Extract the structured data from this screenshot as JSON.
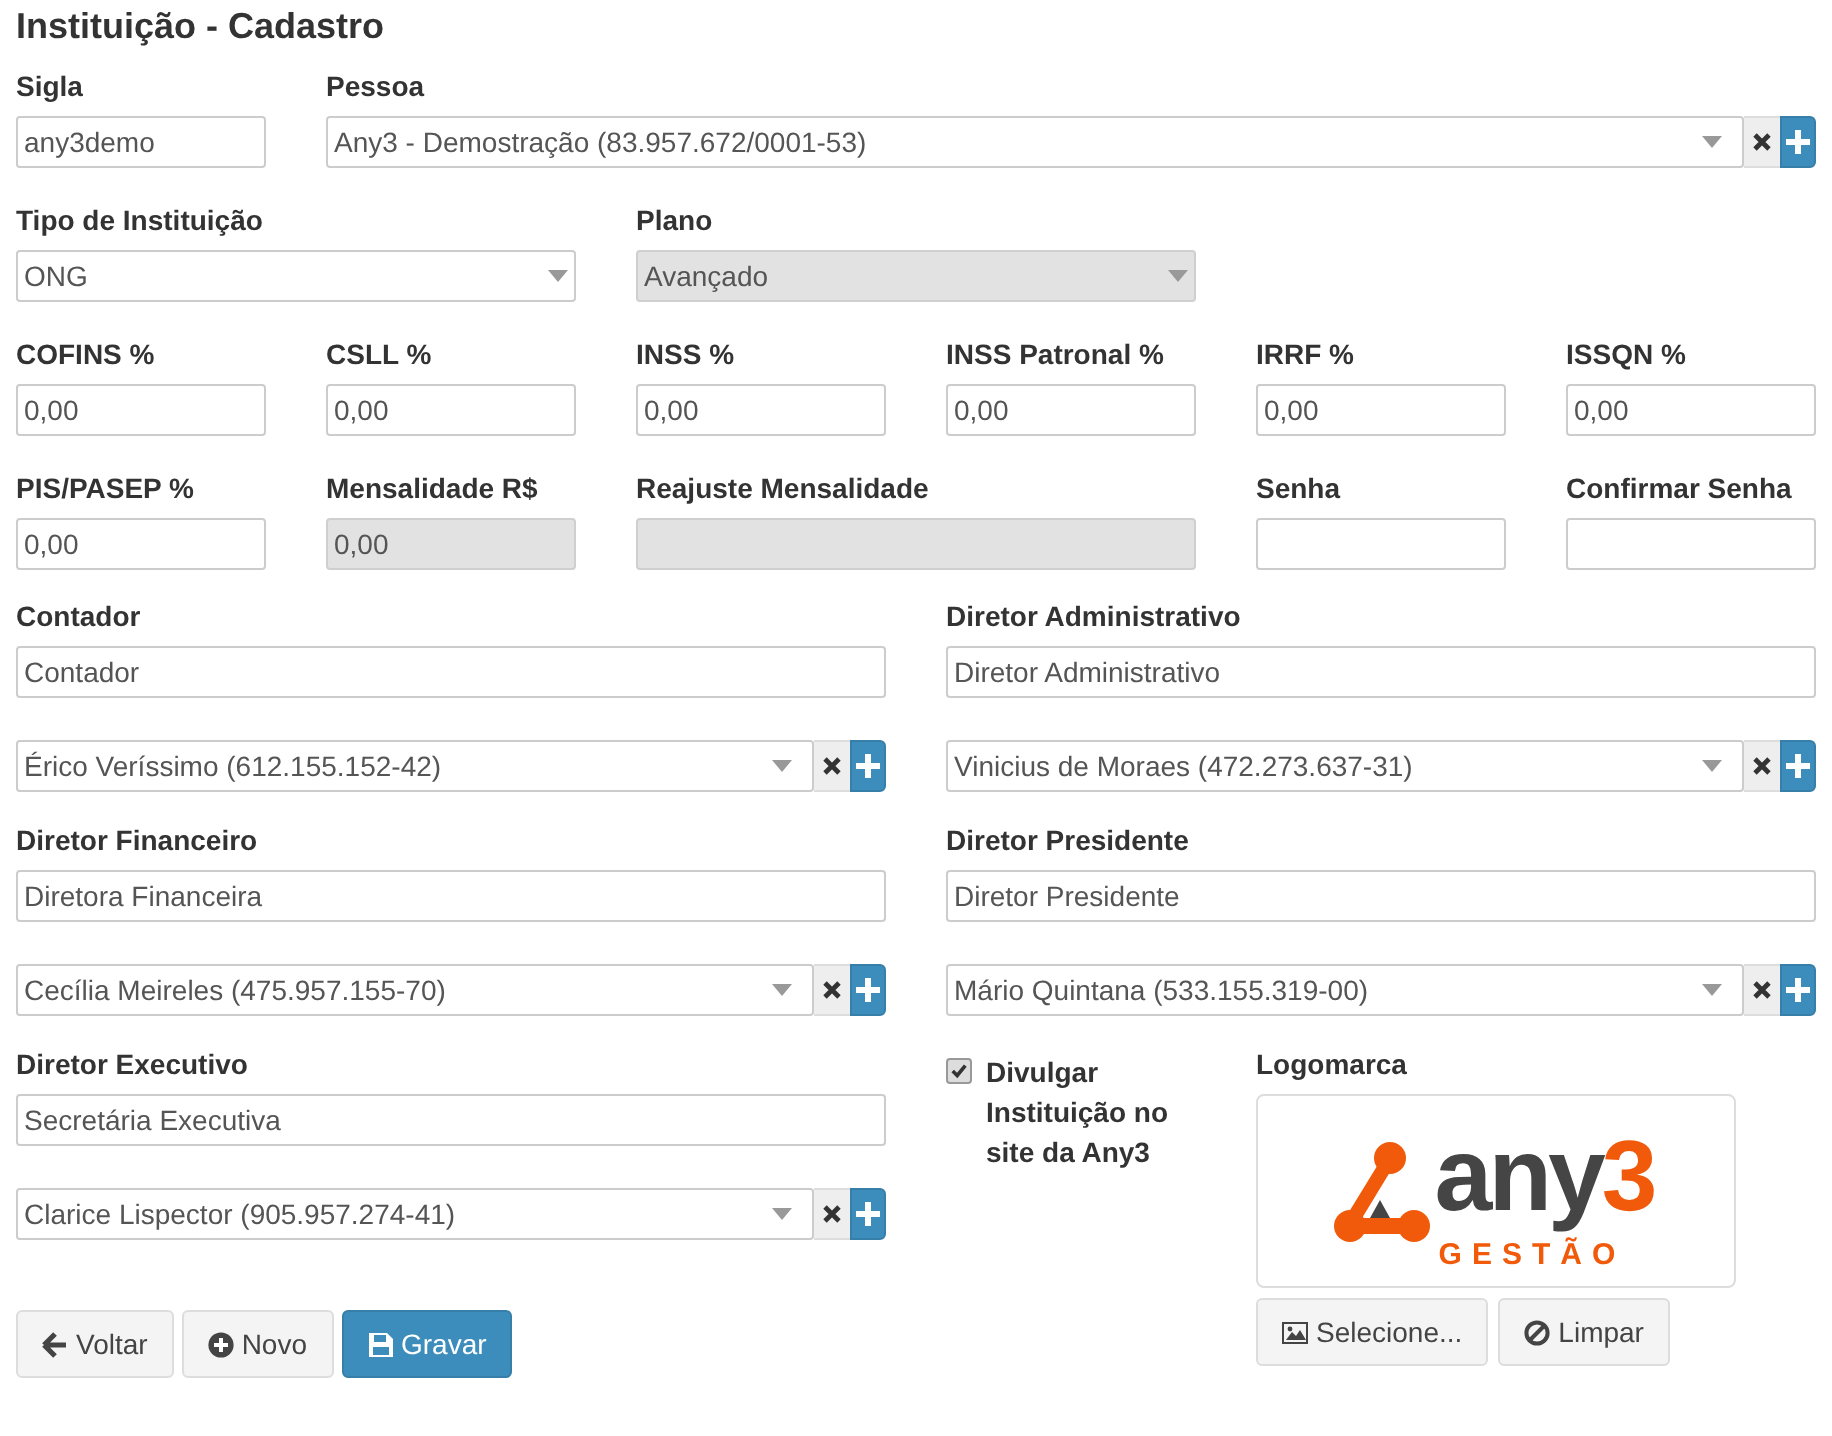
{
  "title": "Instituição - Cadastro",
  "rows": [
    [
      {
        "kind": "input",
        "label": "Sigla",
        "value": "any3demo",
        "disabled": false
      },
      {
        "kind": "lookup",
        "label": "Pessoa",
        "value": "Any3 - Demostração (83.957.672/0001-53)",
        "disabled": false
      }
    ],
    [
      {
        "kind": "select",
        "label": "Tipo de Instituição",
        "value": "ONG",
        "disabled": false
      },
      {
        "kind": "select",
        "label": "Plano",
        "value": "Avançado",
        "disabled": true
      }
    ],
    [
      {
        "kind": "input",
        "label": "COFINS %",
        "value": "0,00",
        "disabled": false
      },
      {
        "kind": "input",
        "label": "CSLL %",
        "value": "0,00",
        "disabled": false
      },
      {
        "kind": "input",
        "label": "INSS %",
        "value": "0,00",
        "disabled": false
      },
      {
        "kind": "input",
        "label": "INSS Patronal %",
        "value": "0,00",
        "disabled": false
      },
      {
        "kind": "input",
        "label": "IRRF %",
        "value": "0,00",
        "disabled": false
      },
      {
        "kind": "input",
        "label": "ISSQN %",
        "value": "0,00",
        "disabled": false
      }
    ],
    [
      {
        "kind": "input",
        "label": "PIS/PASEP %",
        "value": "0,00",
        "disabled": false
      },
      {
        "kind": "input",
        "label": "Mensalidade R$",
        "value": "0,00",
        "disabled": true
      },
      {
        "kind": "wide",
        "label": "Reajuste Mensalidade",
        "disabled": true
      },
      {
        "kind": "input",
        "label": "Senha",
        "disabled": false
      },
      {
        "kind": "input",
        "label": "Confirmar Senha",
        "disabled": false
      }
    ]
  ],
  "left": [
    {
      "label": "Contador",
      "title": "Contador",
      "person": "Érico Veríssimo (612.155.152-42)"
    },
    {
      "label": "Diretor Financeiro",
      "title": "Diretora Financeira",
      "person": "Cecília Meireles (475.957.155-70)"
    },
    {
      "label": "Diretor Executivo",
      "title": "Secretária Executiva",
      "person": "Clarice Lispector (905.957.274-41)"
    }
  ],
  "right": [
    {
      "label": "Diretor Administrativo",
      "title": "Diretor Administrativo",
      "person": "Vinicius de Moraes (472.273.637-31)"
    },
    {
      "label": "Diretor Presidente",
      "title": "Diretor Presidente",
      "person": "Mário Quintana (533.155.319-00)"
    }
  ],
  "publish": {
    "label": "Divulgar Instituição no site da Any3",
    "checked": true
  },
  "logo": {
    "label": "Logomarca",
    "word": "any",
    "digit": "3",
    "tagline": "GESTÃO",
    "buttons": [
      {
        "kind": "image",
        "label": "Selecione..."
      },
      {
        "kind": "clear",
        "label": "Limpar"
      }
    ]
  },
  "buttons": [
    {
      "kind": "back",
      "label": "Voltar"
    },
    {
      "kind": "new",
      "label": "Novo"
    },
    {
      "kind": "save",
      "label": "Gravar"
    }
  ]
}
